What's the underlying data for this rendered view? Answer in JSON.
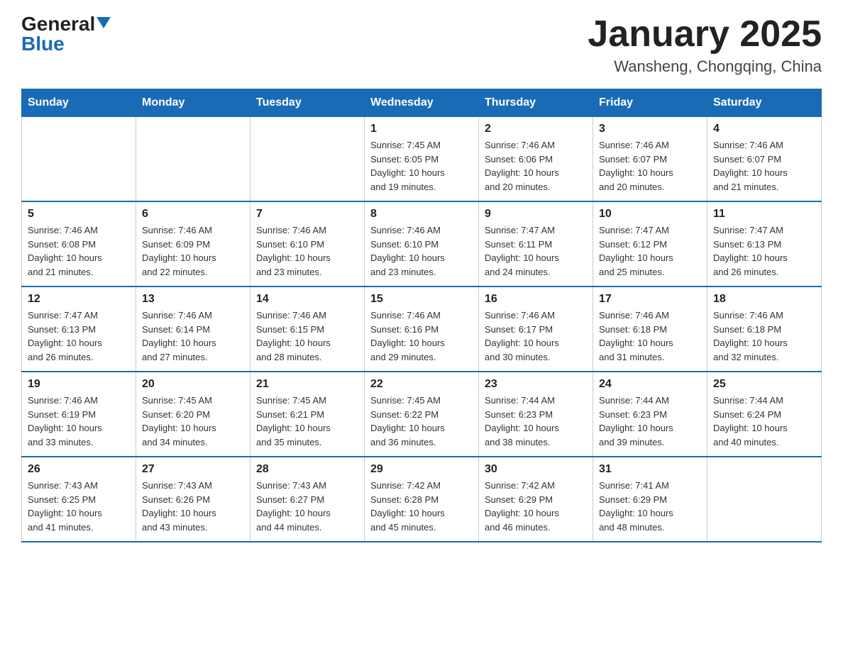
{
  "logo": {
    "general": "General",
    "triangle": "▲",
    "blue": "Blue"
  },
  "header": {
    "title": "January 2025",
    "subtitle": "Wansheng, Chongqing, China"
  },
  "weekdays": [
    "Sunday",
    "Monday",
    "Tuesday",
    "Wednesday",
    "Thursday",
    "Friday",
    "Saturday"
  ],
  "weeks": [
    [
      {
        "day": "",
        "info": ""
      },
      {
        "day": "",
        "info": ""
      },
      {
        "day": "",
        "info": ""
      },
      {
        "day": "1",
        "info": "Sunrise: 7:45 AM\nSunset: 6:05 PM\nDaylight: 10 hours\nand 19 minutes."
      },
      {
        "day": "2",
        "info": "Sunrise: 7:46 AM\nSunset: 6:06 PM\nDaylight: 10 hours\nand 20 minutes."
      },
      {
        "day": "3",
        "info": "Sunrise: 7:46 AM\nSunset: 6:07 PM\nDaylight: 10 hours\nand 20 minutes."
      },
      {
        "day": "4",
        "info": "Sunrise: 7:46 AM\nSunset: 6:07 PM\nDaylight: 10 hours\nand 21 minutes."
      }
    ],
    [
      {
        "day": "5",
        "info": "Sunrise: 7:46 AM\nSunset: 6:08 PM\nDaylight: 10 hours\nand 21 minutes."
      },
      {
        "day": "6",
        "info": "Sunrise: 7:46 AM\nSunset: 6:09 PM\nDaylight: 10 hours\nand 22 minutes."
      },
      {
        "day": "7",
        "info": "Sunrise: 7:46 AM\nSunset: 6:10 PM\nDaylight: 10 hours\nand 23 minutes."
      },
      {
        "day": "8",
        "info": "Sunrise: 7:46 AM\nSunset: 6:10 PM\nDaylight: 10 hours\nand 23 minutes."
      },
      {
        "day": "9",
        "info": "Sunrise: 7:47 AM\nSunset: 6:11 PM\nDaylight: 10 hours\nand 24 minutes."
      },
      {
        "day": "10",
        "info": "Sunrise: 7:47 AM\nSunset: 6:12 PM\nDaylight: 10 hours\nand 25 minutes."
      },
      {
        "day": "11",
        "info": "Sunrise: 7:47 AM\nSunset: 6:13 PM\nDaylight: 10 hours\nand 26 minutes."
      }
    ],
    [
      {
        "day": "12",
        "info": "Sunrise: 7:47 AM\nSunset: 6:13 PM\nDaylight: 10 hours\nand 26 minutes."
      },
      {
        "day": "13",
        "info": "Sunrise: 7:46 AM\nSunset: 6:14 PM\nDaylight: 10 hours\nand 27 minutes."
      },
      {
        "day": "14",
        "info": "Sunrise: 7:46 AM\nSunset: 6:15 PM\nDaylight: 10 hours\nand 28 minutes."
      },
      {
        "day": "15",
        "info": "Sunrise: 7:46 AM\nSunset: 6:16 PM\nDaylight: 10 hours\nand 29 minutes."
      },
      {
        "day": "16",
        "info": "Sunrise: 7:46 AM\nSunset: 6:17 PM\nDaylight: 10 hours\nand 30 minutes."
      },
      {
        "day": "17",
        "info": "Sunrise: 7:46 AM\nSunset: 6:18 PM\nDaylight: 10 hours\nand 31 minutes."
      },
      {
        "day": "18",
        "info": "Sunrise: 7:46 AM\nSunset: 6:18 PM\nDaylight: 10 hours\nand 32 minutes."
      }
    ],
    [
      {
        "day": "19",
        "info": "Sunrise: 7:46 AM\nSunset: 6:19 PM\nDaylight: 10 hours\nand 33 minutes."
      },
      {
        "day": "20",
        "info": "Sunrise: 7:45 AM\nSunset: 6:20 PM\nDaylight: 10 hours\nand 34 minutes."
      },
      {
        "day": "21",
        "info": "Sunrise: 7:45 AM\nSunset: 6:21 PM\nDaylight: 10 hours\nand 35 minutes."
      },
      {
        "day": "22",
        "info": "Sunrise: 7:45 AM\nSunset: 6:22 PM\nDaylight: 10 hours\nand 36 minutes."
      },
      {
        "day": "23",
        "info": "Sunrise: 7:44 AM\nSunset: 6:23 PM\nDaylight: 10 hours\nand 38 minutes."
      },
      {
        "day": "24",
        "info": "Sunrise: 7:44 AM\nSunset: 6:23 PM\nDaylight: 10 hours\nand 39 minutes."
      },
      {
        "day": "25",
        "info": "Sunrise: 7:44 AM\nSunset: 6:24 PM\nDaylight: 10 hours\nand 40 minutes."
      }
    ],
    [
      {
        "day": "26",
        "info": "Sunrise: 7:43 AM\nSunset: 6:25 PM\nDaylight: 10 hours\nand 41 minutes."
      },
      {
        "day": "27",
        "info": "Sunrise: 7:43 AM\nSunset: 6:26 PM\nDaylight: 10 hours\nand 43 minutes."
      },
      {
        "day": "28",
        "info": "Sunrise: 7:43 AM\nSunset: 6:27 PM\nDaylight: 10 hours\nand 44 minutes."
      },
      {
        "day": "29",
        "info": "Sunrise: 7:42 AM\nSunset: 6:28 PM\nDaylight: 10 hours\nand 45 minutes."
      },
      {
        "day": "30",
        "info": "Sunrise: 7:42 AM\nSunset: 6:29 PM\nDaylight: 10 hours\nand 46 minutes."
      },
      {
        "day": "31",
        "info": "Sunrise: 7:41 AM\nSunset: 6:29 PM\nDaylight: 10 hours\nand 48 minutes."
      },
      {
        "day": "",
        "info": ""
      }
    ]
  ]
}
